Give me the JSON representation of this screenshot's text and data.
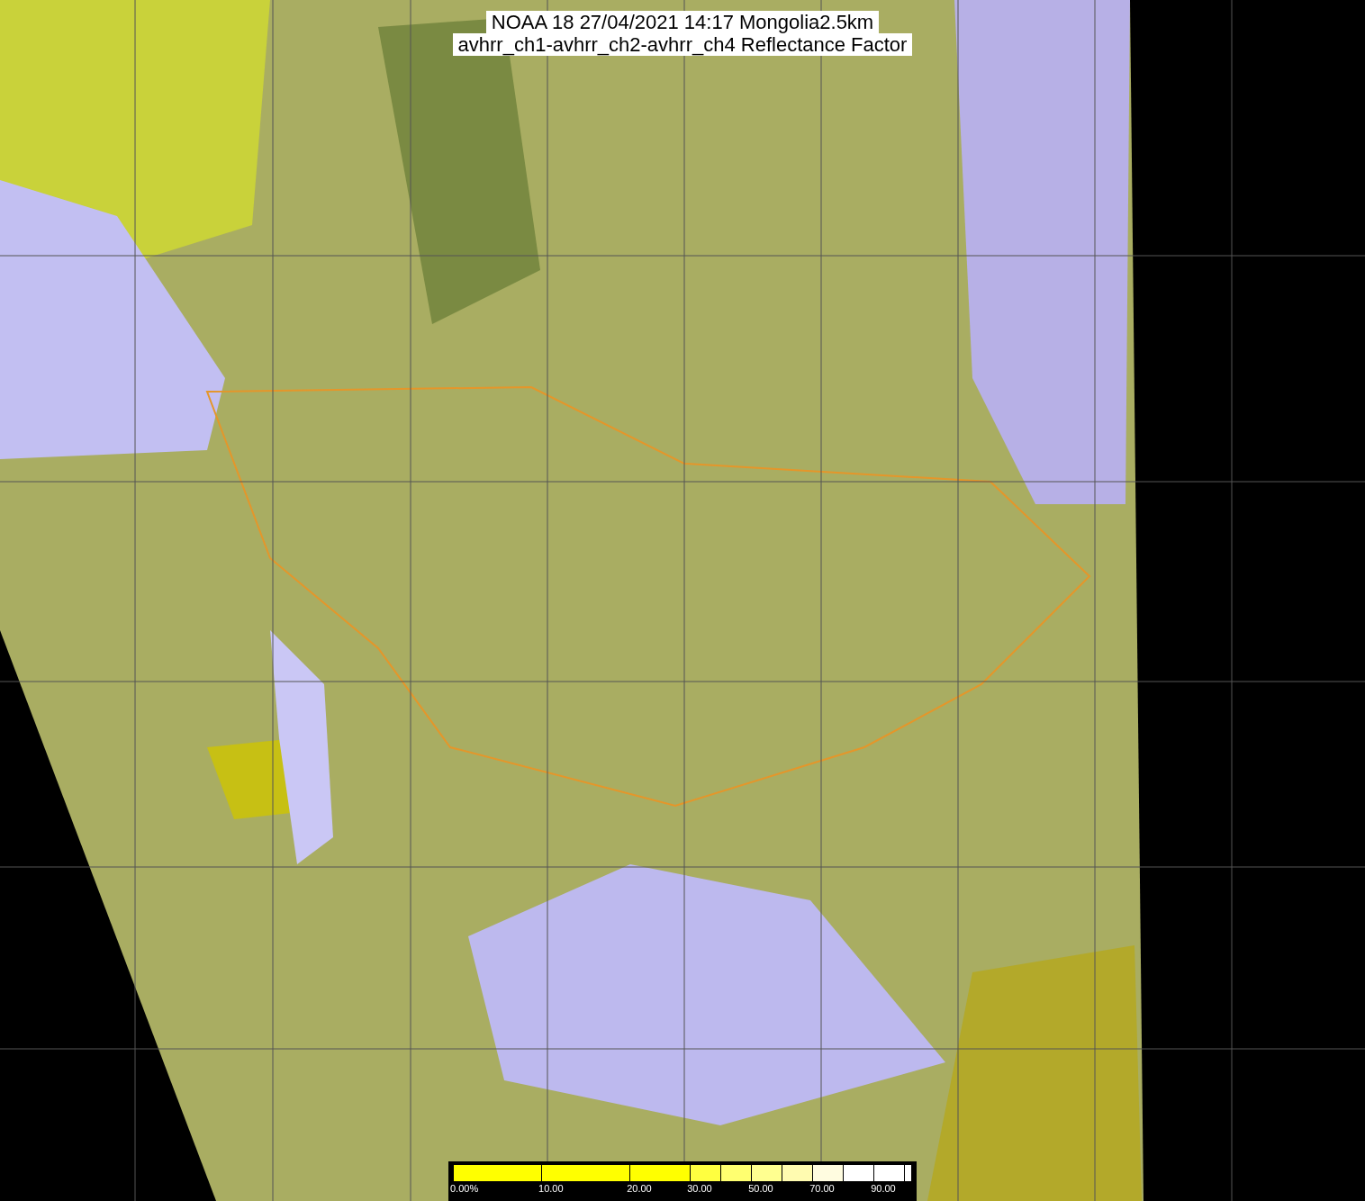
{
  "title": {
    "lines": [
      "NOAA 18 27/04/2021 14:17 Mongolia2.5km",
      "avhrr_ch1-avhrr_ch2-avhrr_ch4 Reflectance Factor"
    ]
  },
  "colorbar": {
    "segments": [
      {
        "color": "#ffff00",
        "label": "0.00%"
      },
      {
        "color": "#ffff00",
        "label": "10.00"
      },
      {
        "color": "#ffff00",
        "label": "20.00"
      },
      {
        "color": "#ffff40",
        "label": "30.00"
      },
      {
        "color": "#ffff70"
      },
      {
        "color": "#ffff90",
        "label": "50.00"
      },
      {
        "color": "#fffbb0"
      },
      {
        "color": "#fffce0",
        "label": "70.00"
      },
      {
        "color": "#ffffff"
      },
      {
        "color": "#ffffff",
        "label": "90.00"
      },
      {
        "color": "#ffffff"
      }
    ]
  }
}
